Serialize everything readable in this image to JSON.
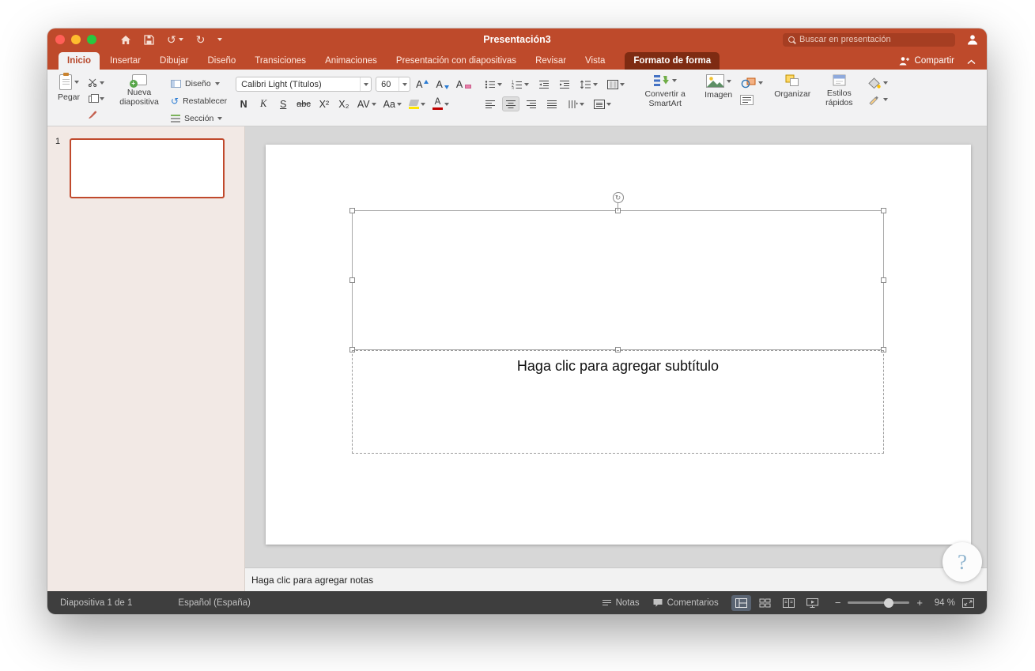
{
  "colors": {
    "titlebar": "#BE4A2B",
    "accent": "#B7472A",
    "contextual_tab": "#7E2B12",
    "selection_border": "#C0492C"
  },
  "window": {
    "title": "Presentación3",
    "search_placeholder": "Buscar en presentación"
  },
  "tabs": [
    {
      "label": "Inicio"
    },
    {
      "label": "Insertar"
    },
    {
      "label": "Dibujar"
    },
    {
      "label": "Diseño"
    },
    {
      "label": "Transiciones"
    },
    {
      "label": "Animaciones"
    },
    {
      "label": "Presentación con diapositivas"
    },
    {
      "label": "Revisar"
    },
    {
      "label": "Vista"
    },
    {
      "label": "Formato de forma"
    }
  ],
  "share_label": "Compartir",
  "ribbon": {
    "paste": "Pegar",
    "new_slide": "Nueva diapositiva",
    "layout": "Diseño",
    "reset": "Restablecer",
    "section": "Sección",
    "font_name": "Calibri Light (Títulos)",
    "font_size": "60",
    "bold": "N",
    "italic": "K",
    "underline": "S",
    "strikethrough": "abc",
    "superscript": "X²",
    "subscript": "X₂",
    "char_spacing": "AV",
    "change_case": "Aa",
    "smartart": "Convertir a SmartArt",
    "image": "Imagen",
    "arrange": "Organizar",
    "quick_styles": "Estilos rápidos"
  },
  "icons": {
    "undo": "↺",
    "redo": "↻",
    "reset": "↺",
    "rotate": "↻",
    "grow_font": "A",
    "shrink_font": "A",
    "clear_format": "A",
    "font_color": "A",
    "zoom_out": "−",
    "zoom_in": "+",
    "help": "?"
  },
  "slide_panel": {
    "slide_number": "1"
  },
  "slide": {
    "subtitle_placeholder": "Haga clic para agregar subtítulo"
  },
  "notes": {
    "placeholder": "Haga clic para agregar notas"
  },
  "status_bar": {
    "slide_info": "Diapositiva 1 de 1",
    "language": "Español (España)",
    "notes": "Notas",
    "comments": "Comentarios",
    "zoom_level": "94 %"
  }
}
